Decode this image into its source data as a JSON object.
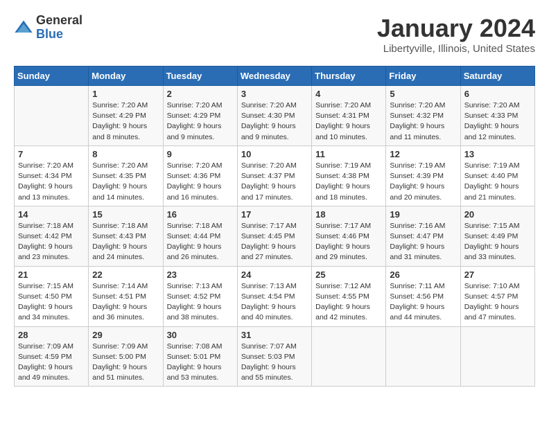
{
  "logo": {
    "general": "General",
    "blue": "Blue"
  },
  "header": {
    "month": "January 2024",
    "location": "Libertyville, Illinois, United States"
  },
  "days_of_week": [
    "Sunday",
    "Monday",
    "Tuesday",
    "Wednesday",
    "Thursday",
    "Friday",
    "Saturday"
  ],
  "weeks": [
    [
      {
        "day": "",
        "info": ""
      },
      {
        "day": "1",
        "info": "Sunrise: 7:20 AM\nSunset: 4:29 PM\nDaylight: 9 hours\nand 8 minutes."
      },
      {
        "day": "2",
        "info": "Sunrise: 7:20 AM\nSunset: 4:29 PM\nDaylight: 9 hours\nand 9 minutes."
      },
      {
        "day": "3",
        "info": "Sunrise: 7:20 AM\nSunset: 4:30 PM\nDaylight: 9 hours\nand 9 minutes."
      },
      {
        "day": "4",
        "info": "Sunrise: 7:20 AM\nSunset: 4:31 PM\nDaylight: 9 hours\nand 10 minutes."
      },
      {
        "day": "5",
        "info": "Sunrise: 7:20 AM\nSunset: 4:32 PM\nDaylight: 9 hours\nand 11 minutes."
      },
      {
        "day": "6",
        "info": "Sunrise: 7:20 AM\nSunset: 4:33 PM\nDaylight: 9 hours\nand 12 minutes."
      }
    ],
    [
      {
        "day": "7",
        "info": "Sunrise: 7:20 AM\nSunset: 4:34 PM\nDaylight: 9 hours\nand 13 minutes."
      },
      {
        "day": "8",
        "info": "Sunrise: 7:20 AM\nSunset: 4:35 PM\nDaylight: 9 hours\nand 14 minutes."
      },
      {
        "day": "9",
        "info": "Sunrise: 7:20 AM\nSunset: 4:36 PM\nDaylight: 9 hours\nand 16 minutes."
      },
      {
        "day": "10",
        "info": "Sunrise: 7:20 AM\nSunset: 4:37 PM\nDaylight: 9 hours\nand 17 minutes."
      },
      {
        "day": "11",
        "info": "Sunrise: 7:19 AM\nSunset: 4:38 PM\nDaylight: 9 hours\nand 18 minutes."
      },
      {
        "day": "12",
        "info": "Sunrise: 7:19 AM\nSunset: 4:39 PM\nDaylight: 9 hours\nand 20 minutes."
      },
      {
        "day": "13",
        "info": "Sunrise: 7:19 AM\nSunset: 4:40 PM\nDaylight: 9 hours\nand 21 minutes."
      }
    ],
    [
      {
        "day": "14",
        "info": "Sunrise: 7:18 AM\nSunset: 4:42 PM\nDaylight: 9 hours\nand 23 minutes."
      },
      {
        "day": "15",
        "info": "Sunrise: 7:18 AM\nSunset: 4:43 PM\nDaylight: 9 hours\nand 24 minutes."
      },
      {
        "day": "16",
        "info": "Sunrise: 7:18 AM\nSunset: 4:44 PM\nDaylight: 9 hours\nand 26 minutes."
      },
      {
        "day": "17",
        "info": "Sunrise: 7:17 AM\nSunset: 4:45 PM\nDaylight: 9 hours\nand 27 minutes."
      },
      {
        "day": "18",
        "info": "Sunrise: 7:17 AM\nSunset: 4:46 PM\nDaylight: 9 hours\nand 29 minutes."
      },
      {
        "day": "19",
        "info": "Sunrise: 7:16 AM\nSunset: 4:47 PM\nDaylight: 9 hours\nand 31 minutes."
      },
      {
        "day": "20",
        "info": "Sunrise: 7:15 AM\nSunset: 4:49 PM\nDaylight: 9 hours\nand 33 minutes."
      }
    ],
    [
      {
        "day": "21",
        "info": "Sunrise: 7:15 AM\nSunset: 4:50 PM\nDaylight: 9 hours\nand 34 minutes."
      },
      {
        "day": "22",
        "info": "Sunrise: 7:14 AM\nSunset: 4:51 PM\nDaylight: 9 hours\nand 36 minutes."
      },
      {
        "day": "23",
        "info": "Sunrise: 7:13 AM\nSunset: 4:52 PM\nDaylight: 9 hours\nand 38 minutes."
      },
      {
        "day": "24",
        "info": "Sunrise: 7:13 AM\nSunset: 4:54 PM\nDaylight: 9 hours\nand 40 minutes."
      },
      {
        "day": "25",
        "info": "Sunrise: 7:12 AM\nSunset: 4:55 PM\nDaylight: 9 hours\nand 42 minutes."
      },
      {
        "day": "26",
        "info": "Sunrise: 7:11 AM\nSunset: 4:56 PM\nDaylight: 9 hours\nand 44 minutes."
      },
      {
        "day": "27",
        "info": "Sunrise: 7:10 AM\nSunset: 4:57 PM\nDaylight: 9 hours\nand 47 minutes."
      }
    ],
    [
      {
        "day": "28",
        "info": "Sunrise: 7:09 AM\nSunset: 4:59 PM\nDaylight: 9 hours\nand 49 minutes."
      },
      {
        "day": "29",
        "info": "Sunrise: 7:09 AM\nSunset: 5:00 PM\nDaylight: 9 hours\nand 51 minutes."
      },
      {
        "day": "30",
        "info": "Sunrise: 7:08 AM\nSunset: 5:01 PM\nDaylight: 9 hours\nand 53 minutes."
      },
      {
        "day": "31",
        "info": "Sunrise: 7:07 AM\nSunset: 5:03 PM\nDaylight: 9 hours\nand 55 minutes."
      },
      {
        "day": "",
        "info": ""
      },
      {
        "day": "",
        "info": ""
      },
      {
        "day": "",
        "info": ""
      }
    ]
  ]
}
